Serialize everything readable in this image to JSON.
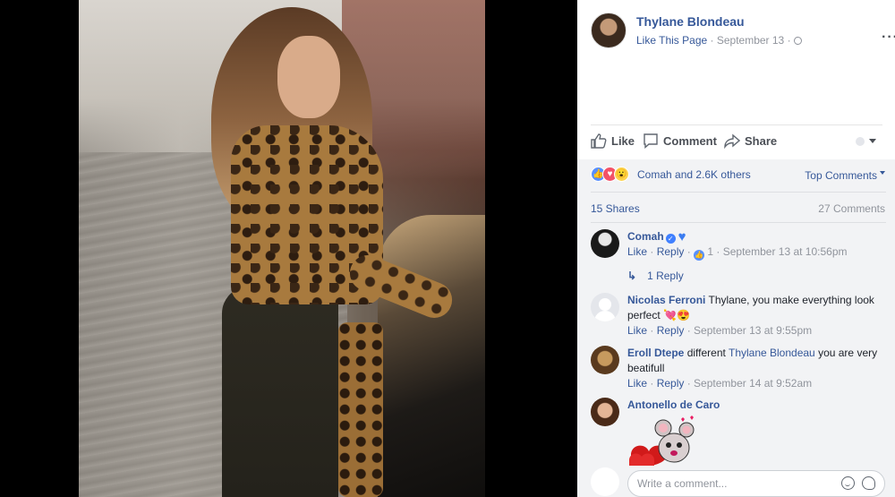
{
  "post": {
    "page_name": "Thylane Blondeau",
    "like_page": "Like This Page",
    "separator": " · ",
    "date": "September 13",
    "more": "···"
  },
  "actions": {
    "like": "Like",
    "comment": "Comment",
    "share": "Share"
  },
  "reactions": {
    "summary": "Comah and 2.6K others",
    "top_comments": "Top Comments",
    "types": [
      "like",
      "love",
      "wow"
    ]
  },
  "counts": {
    "shares": "15 Shares",
    "comments": "27 Comments"
  },
  "comments": [
    {
      "author": "Comah",
      "text": "",
      "like": "Like",
      "reply": "Reply",
      "reaction_count": "1",
      "time": "September 13 at 10:56pm",
      "replies": "1 Reply"
    },
    {
      "author": "Nicolas Ferroni",
      "text": "Thylane, you make everything look perfect",
      "emoji": "💘😍",
      "like": "Like",
      "reply": "Reply",
      "time": "September 13 at 9:55pm"
    },
    {
      "author": "Eroll Dtepe",
      "text_before": "different",
      "mention": "Thylane Blondeau",
      "text_after": "you are very beatifull",
      "like": "Like",
      "reply": "Reply",
      "time": "September 14 at 9:52am"
    },
    {
      "author": "Antonello de Caro"
    }
  ],
  "composer": {
    "placeholder": "Write a comment..."
  },
  "colors": {
    "link": "#365899",
    "muted": "#90949c",
    "panel_bg": "#f2f3f5",
    "like_blue": "#5890ff",
    "love_red": "#f25268"
  }
}
